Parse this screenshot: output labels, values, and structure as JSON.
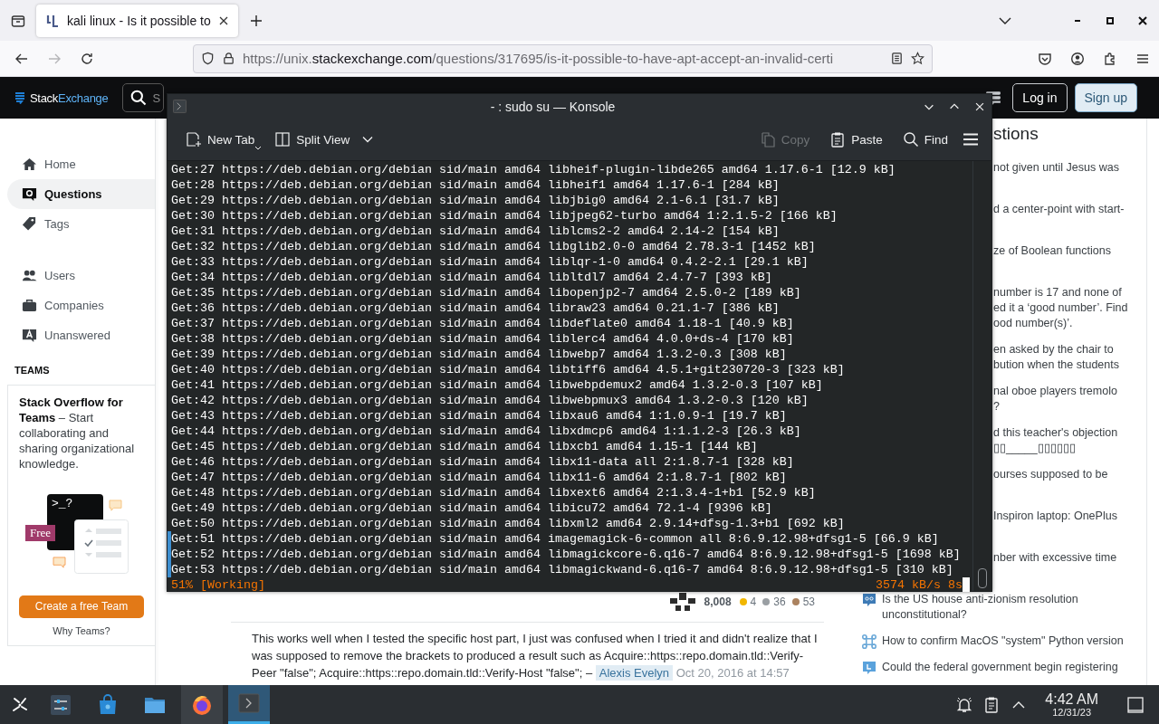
{
  "browser": {
    "tab": {
      "title": "kali linux - Is it possible to",
      "selected": true
    },
    "forward_disabled": true,
    "url": {
      "prefix": "https://unix.",
      "host": "stackexchange.com",
      "path": "/questions/317695/is-it-possible-to-have-apt-accept-an-invalid-certi"
    }
  },
  "site": {
    "logo": [
      "Stack",
      "Exchange"
    ],
    "search_placeholder": "S",
    "login": "Log in",
    "signup": "Sign up"
  },
  "sidebar": {
    "groups": [
      {
        "items": [
          {
            "label": "Home",
            "kind": "home",
            "selected": false
          },
          {
            "label": "Questions",
            "kind": "questions",
            "selected": true
          },
          {
            "label": "Tags",
            "kind": "tags",
            "selected": false
          }
        ]
      },
      {
        "items": [
          {
            "label": "Users",
            "kind": "users",
            "selected": false
          },
          {
            "label": "Companies",
            "kind": "companies",
            "selected": false
          },
          {
            "label": "Unanswered",
            "kind": "unanswered",
            "selected": false
          }
        ]
      }
    ],
    "teams_heading": "TEAMS",
    "teams_card": {
      "text": "**Stack Overflow for Teams** – Start collaborating and sharing organizational knowledge.",
      "prompt": ">_?",
      "badge": "Free",
      "button": "Create a free Team",
      "link": "Why Teams?"
    }
  },
  "post": {
    "reputation": "8,008",
    "badges": [
      {
        "count": "4",
        "color": "#f1b600"
      },
      {
        "count": "36",
        "color": "#9a9fa3"
      },
      {
        "count": "53",
        "color": "#ab825f"
      }
    ],
    "comment": {
      "text": "This works well when I tested the specific host part, I just was confused when I tried it and didn't realize that I was supposed to remove the brackets to produced a result such as Acquire::https::repo.domain.tld::Verify-Peer \"false\"; Acquire::https::repo.domain.tld::Verify-Host \"false\"; –",
      "author": "Alexis Evelyn",
      "date": "Oct 20, 2016 at 14:57"
    }
  },
  "hot_questions": {
    "heading": "stions",
    "items": [
      {
        "lines": [
          "not given until Jesus was"
        ],
        "covered": true
      },
      {
        "lines": [
          "d a center-point with start-"
        ],
        "covered": true
      },
      {
        "lines": [
          "ze of Boolean functions"
        ],
        "covered": true
      },
      {
        "lines": [
          "number is 17 and none of",
          "ed it a ‘good number’. Find",
          "ood number(s)’."
        ],
        "covered": true
      },
      {
        "lines": [
          "en asked by the chair to",
          "bution when the students"
        ],
        "covered": true
      },
      {
        "lines": [
          "nal oboe players tremolo",
          "?"
        ],
        "covered": true
      },
      {
        "lines": [
          "d this teacher's objection",
          "▯▯_____▯▯▯▯▯▯"
        ],
        "covered": true
      },
      {
        "lines": [
          "ourses supposed to be"
        ],
        "covered": true
      },
      {
        "lines": [
          "Inspiron laptop: OnePlus"
        ],
        "covered": true
      },
      {
        "lines": [
          "nber with excessive time"
        ],
        "covered": true
      },
      {
        "lines": [
          "Is the US house anti-zionism resolution",
          "unconstitutional?"
        ],
        "covered": false,
        "kind": "politics"
      },
      {
        "lines": [
          "How to confirm MacOS \"system\" Python version"
        ],
        "covered": false,
        "kind": "apple"
      },
      {
        "lines": [
          "Could the federal government begin registering"
        ],
        "covered": false,
        "kind": "law"
      }
    ]
  },
  "konsole": {
    "title": "- : sudo su — Konsole",
    "toolbar": [
      {
        "label": "New Tab",
        "kind": "new-tab",
        "disabled": false
      },
      {
        "label": "Split View",
        "kind": "split",
        "disabled": false
      },
      {
        "label": "Copy",
        "kind": "copy",
        "disabled": true
      },
      {
        "label": "Paste",
        "kind": "paste",
        "disabled": false
      },
      {
        "label": "Find",
        "kind": "find",
        "disabled": false
      }
    ],
    "lines": [
      {
        "text": "Get:27 https://deb.debian.org/debian sid/main amd64 libheif-plugin-libde265 amd64 1.17.6-1 [12.9 kB]",
        "marked": false
      },
      {
        "text": "Get:28 https://deb.debian.org/debian sid/main amd64 libheif1 amd64 1.17.6-1 [284 kB]",
        "marked": false
      },
      {
        "text": "Get:29 https://deb.debian.org/debian sid/main amd64 libjbig0 amd64 2.1-6.1 [31.7 kB]",
        "marked": false
      },
      {
        "text": "Get:30 https://deb.debian.org/debian sid/main amd64 libjpeg62-turbo amd64 1:2.1.5-2 [166 kB]",
        "marked": false
      },
      {
        "text": "Get:31 https://deb.debian.org/debian sid/main amd64 liblcms2-2 amd64 2.14-2 [154 kB]",
        "marked": false
      },
      {
        "text": "Get:32 https://deb.debian.org/debian sid/main amd64 libglib2.0-0 amd64 2.78.3-1 [1452 kB]",
        "marked": false
      },
      {
        "text": "Get:33 https://deb.debian.org/debian sid/main amd64 liblqr-1-0 amd64 0.4.2-2.1 [29.1 kB]",
        "marked": false
      },
      {
        "text": "Get:34 https://deb.debian.org/debian sid/main amd64 libltdl7 amd64 2.4.7-7 [393 kB]",
        "marked": false
      },
      {
        "text": "Get:35 https://deb.debian.org/debian sid/main amd64 libopenjp2-7 amd64 2.5.0-2 [189 kB]",
        "marked": false
      },
      {
        "text": "Get:36 https://deb.debian.org/debian sid/main amd64 libraw23 amd64 0.21.1-7 [386 kB]",
        "marked": false
      },
      {
        "text": "Get:37 https://deb.debian.org/debian sid/main amd64 libdeflate0 amd64 1.18-1 [40.9 kB]",
        "marked": false
      },
      {
        "text": "Get:38 https://deb.debian.org/debian sid/main amd64 liblerc4 amd64 4.0.0+ds-4 [170 kB]",
        "marked": false
      },
      {
        "text": "Get:39 https://deb.debian.org/debian sid/main amd64 libwebp7 amd64 1.3.2-0.3 [308 kB]",
        "marked": false
      },
      {
        "text": "Get:40 https://deb.debian.org/debian sid/main amd64 libtiff6 amd64 4.5.1+git230720-3 [323 kB]",
        "marked": false
      },
      {
        "text": "Get:41 https://deb.debian.org/debian sid/main amd64 libwebpdemux2 amd64 1.3.2-0.3 [107 kB]",
        "marked": false
      },
      {
        "text": "Get:42 https://deb.debian.org/debian sid/main amd64 libwebpmux3 amd64 1.3.2-0.3 [120 kB]",
        "marked": false
      },
      {
        "text": "Get:43 https://deb.debian.org/debian sid/main amd64 libxau6 amd64 1:1.0.9-1 [19.7 kB]",
        "marked": false
      },
      {
        "text": "Get:44 https://deb.debian.org/debian sid/main amd64 libxdmcp6 amd64 1:1.1.2-3 [26.3 kB]",
        "marked": false
      },
      {
        "text": "Get:45 https://deb.debian.org/debian sid/main amd64 libxcb1 amd64 1.15-1 [144 kB]",
        "marked": false
      },
      {
        "text": "Get:46 https://deb.debian.org/debian sid/main amd64 libx11-data all 2:1.8.7-1 [328 kB]",
        "marked": false
      },
      {
        "text": "Get:47 https://deb.debian.org/debian sid/main amd64 libx11-6 amd64 2:1.8.7-1 [802 kB]",
        "marked": false
      },
      {
        "text": "Get:48 https://deb.debian.org/debian sid/main amd64 libxext6 amd64 2:1.3.4-1+b1 [52.9 kB]",
        "marked": false
      },
      {
        "text": "Get:49 https://deb.debian.org/debian sid/main amd64 libicu72 amd64 72.1-4 [9396 kB]",
        "marked": false
      },
      {
        "text": "Get:50 https://deb.debian.org/debian sid/main amd64 libxml2 amd64 2.9.14+dfsg-1.3+b1 [692 kB]",
        "marked": false
      },
      {
        "text": "Get:51 https://deb.debian.org/debian sid/main amd64 imagemagick-6-common all 8:6.9.12.98+dfsg1-5 [66.9 kB]",
        "marked": true
      },
      {
        "text": "Get:52 https://deb.debian.org/debian sid/main amd64 libmagickcore-6.q16-7 amd64 8:6.9.12.98+dfsg1-5 [1698 kB]",
        "marked": true
      },
      {
        "text": "Get:53 https://deb.debian.org/debian sid/main amd64 libmagickwand-6.q16-7 amd64 8:6.9.12.98+dfsg1-5 [310 kB]",
        "marked": true
      }
    ],
    "status": {
      "progress": "51% [Working]",
      "rate": "3574 kB/s 8s"
    }
  },
  "taskbar": {
    "tasks": [
      {
        "kind": "settings",
        "running": false,
        "selected": false
      },
      {
        "kind": "store",
        "running": false,
        "selected": false
      },
      {
        "kind": "files",
        "running": false,
        "selected": false
      },
      {
        "kind": "firefox",
        "running": true,
        "selected": false
      },
      {
        "kind": "konsole",
        "running": true,
        "selected": true
      }
    ],
    "time": "4:42 AM",
    "date": "12/31/23"
  }
}
